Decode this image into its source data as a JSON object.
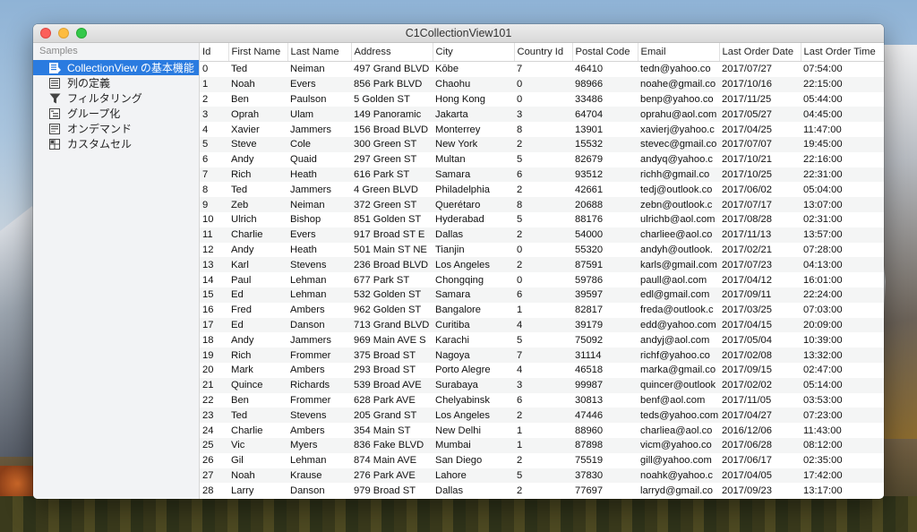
{
  "window": {
    "title": "C1CollectionView101"
  },
  "sidebar": {
    "header": "Samples",
    "items": [
      {
        "label": "CollectionView の基本機能",
        "icon": "list-icon",
        "selected": true
      },
      {
        "label": "列の定義",
        "icon": "column-list-icon",
        "selected": false
      },
      {
        "label": "フィルタリング",
        "icon": "filter-icon",
        "selected": false
      },
      {
        "label": "グループ化",
        "icon": "group-icon",
        "selected": false
      },
      {
        "label": "オンデマンド",
        "icon": "on-demand-icon",
        "selected": false
      },
      {
        "label": "カスタムセル",
        "icon": "custom-cell-icon",
        "selected": false
      }
    ]
  },
  "grid": {
    "columns": [
      "Id",
      "First Name",
      "Last Name",
      "Address",
      "City",
      "Country Id",
      "Postal Code",
      "Email",
      "Last Order Date",
      "Last Order Time"
    ],
    "rows": [
      [
        "0",
        "Ted",
        "Neiman",
        "497 Grand BLVD",
        "Kōbe",
        "7",
        "46410",
        "tedn@yahoo.co",
        "2017/07/27",
        "07:54:00"
      ],
      [
        "1",
        "Noah",
        "Evers",
        "856 Park BLVD",
        "Chaohu",
        "0",
        "98966",
        "noahe@gmail.co",
        "2017/10/16",
        "22:15:00"
      ],
      [
        "2",
        "Ben",
        "Paulson",
        "5 Golden ST",
        "Hong Kong",
        "0",
        "33486",
        "benp@yahoo.co",
        "2017/11/25",
        "05:44:00"
      ],
      [
        "3",
        "Oprah",
        "Ulam",
        "149 Panoramic",
        "Jakarta",
        "3",
        "64704",
        "oprahu@aol.com",
        "2017/05/27",
        "04:45:00"
      ],
      [
        "4",
        "Xavier",
        "Jammers",
        "156 Broad BLVD",
        "Monterrey",
        "8",
        "13901",
        "xavierj@yahoo.c",
        "2017/04/25",
        "11:47:00"
      ],
      [
        "5",
        "Steve",
        "Cole",
        "300 Green ST",
        "New York",
        "2",
        "15532",
        "stevec@gmail.co",
        "2017/07/07",
        "19:45:00"
      ],
      [
        "6",
        "Andy",
        "Quaid",
        "297 Green ST",
        "Multan",
        "5",
        "82679",
        "andyq@yahoo.c",
        "2017/10/21",
        "22:16:00"
      ],
      [
        "7",
        "Rich",
        "Heath",
        "616 Park ST",
        "Samara",
        "6",
        "93512",
        "richh@gmail.co",
        "2017/10/25",
        "22:31:00"
      ],
      [
        "8",
        "Ted",
        "Jammers",
        "4 Green BLVD",
        "Philadelphia",
        "2",
        "42661",
        "tedj@outlook.co",
        "2017/06/02",
        "05:04:00"
      ],
      [
        "9",
        "Zeb",
        "Neiman",
        "372 Green ST",
        "Querétaro",
        "8",
        "20688",
        "zebn@outlook.c",
        "2017/07/17",
        "13:07:00"
      ],
      [
        "10",
        "Ulrich",
        "Bishop",
        "851 Golden ST",
        "Hyderabad",
        "5",
        "88176",
        "ulrichb@aol.com",
        "2017/08/28",
        "02:31:00"
      ],
      [
        "11",
        "Charlie",
        "Evers",
        "917 Broad ST E",
        "Dallas",
        "2",
        "54000",
        "charliee@aol.co",
        "2017/11/13",
        "13:57:00"
      ],
      [
        "12",
        "Andy",
        "Heath",
        "501 Main ST NE",
        "Tianjin",
        "0",
        "55320",
        "andyh@outlook.",
        "2017/02/21",
        "07:28:00"
      ],
      [
        "13",
        "Karl",
        "Stevens",
        "236 Broad BLVD",
        "Los Angeles",
        "2",
        "87591",
        "karls@gmail.com",
        "2017/07/23",
        "04:13:00"
      ],
      [
        "14",
        "Paul",
        "Lehman",
        "677 Park ST",
        "Chongqing",
        "0",
        "59786",
        "paull@aol.com",
        "2017/04/12",
        "16:01:00"
      ],
      [
        "15",
        "Ed",
        "Lehman",
        "532 Golden ST",
        "Samara",
        "6",
        "39597",
        "edl@gmail.com",
        "2017/09/11",
        "22:24:00"
      ],
      [
        "16",
        "Fred",
        "Ambers",
        "962 Golden ST",
        "Bangalore",
        "1",
        "82817",
        "freda@outlook.c",
        "2017/03/25",
        "07:03:00"
      ],
      [
        "17",
        "Ed",
        "Danson",
        "713 Grand BLVD",
        "Curitiba",
        "4",
        "39179",
        "edd@yahoo.com",
        "2017/04/15",
        "20:09:00"
      ],
      [
        "18",
        "Andy",
        "Jammers",
        "969 Main AVE S",
        "Karachi",
        "5",
        "75092",
        "andyj@aol.com",
        "2017/05/04",
        "10:39:00"
      ],
      [
        "19",
        "Rich",
        "Frommer",
        "375 Broad ST",
        "Nagoya",
        "7",
        "31114",
        "richf@yahoo.co",
        "2017/02/08",
        "13:32:00"
      ],
      [
        "20",
        "Mark",
        "Ambers",
        "293 Broad ST",
        "Porto Alegre",
        "4",
        "46518",
        "marka@gmail.co",
        "2017/09/15",
        "02:47:00"
      ],
      [
        "21",
        "Quince",
        "Richards",
        "539 Broad AVE",
        "Surabaya",
        "3",
        "99987",
        "quincer@outlook",
        "2017/02/02",
        "05:14:00"
      ],
      [
        "22",
        "Ben",
        "Frommer",
        "628 Park AVE",
        "Chelyabinsk",
        "6",
        "30813",
        "benf@aol.com",
        "2017/11/05",
        "03:53:00"
      ],
      [
        "23",
        "Ted",
        "Stevens",
        "205 Grand ST",
        "Los Angeles",
        "2",
        "47446",
        "teds@yahoo.com",
        "2017/04/27",
        "07:23:00"
      ],
      [
        "24",
        "Charlie",
        "Ambers",
        "354 Main ST",
        "New Delhi",
        "1",
        "88960",
        "charliea@aol.co",
        "2016/12/06",
        "11:43:00"
      ],
      [
        "25",
        "Vic",
        "Myers",
        "836 Fake BLVD",
        "Mumbai",
        "1",
        "87898",
        "vicm@yahoo.co",
        "2017/06/28",
        "08:12:00"
      ],
      [
        "26",
        "Gil",
        "Lehman",
        "874 Main AVE",
        "San Diego",
        "2",
        "75519",
        "gill@yahoo.com",
        "2017/06/17",
        "02:35:00"
      ],
      [
        "27",
        "Noah",
        "Krause",
        "276 Park AVE",
        "Lahore",
        "5",
        "37830",
        "noahk@yahoo.c",
        "2017/04/05",
        "17:42:00"
      ],
      [
        "28",
        "Larry",
        "Danson",
        "979 Broad ST",
        "Dallas",
        "2",
        "77697",
        "larryd@gmail.co",
        "2017/09/23",
        "13:17:00"
      ]
    ]
  },
  "colors": {
    "selection": "#2a7be0",
    "alt_row": "#f4f5f5"
  }
}
